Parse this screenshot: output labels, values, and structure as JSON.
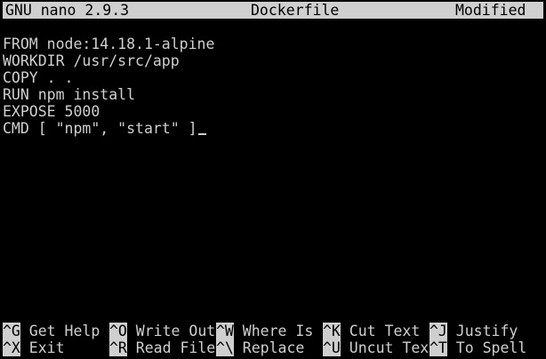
{
  "window": {
    "app_title": "GNU nano 2.9.3",
    "file_name": "Dockerfile",
    "status": "Modified"
  },
  "editor": {
    "lines": [
      "",
      "FROM node:14.18.1-alpine",
      "WORKDIR /usr/src/app",
      "COPY . .",
      "RUN npm install",
      "EXPOSE 5000",
      "CMD [ \"npm\", \"start\" ]"
    ]
  },
  "shortcuts": {
    "row1": [
      {
        "key": "^G",
        "label": " Get Help"
      },
      {
        "key": "^O",
        "label": " Write Out"
      },
      {
        "key": "^W",
        "label": " Where Is"
      },
      {
        "key": "^K",
        "label": " Cut Text"
      },
      {
        "key": "^J",
        "label": " Justify"
      }
    ],
    "row2": [
      {
        "key": "^X",
        "label": " Exit"
      },
      {
        "key": "^R",
        "label": " Read File"
      },
      {
        "key": "^\\",
        "label": " Replace"
      },
      {
        "key": "^U",
        "label": " Uncut Tex"
      },
      {
        "key": "^T",
        "label": " To Spell"
      }
    ]
  },
  "colors": {
    "background": "#000000",
    "foreground": "#cfcfcf",
    "inverse_bg": "#cfcfcf",
    "inverse_fg": "#000000"
  }
}
